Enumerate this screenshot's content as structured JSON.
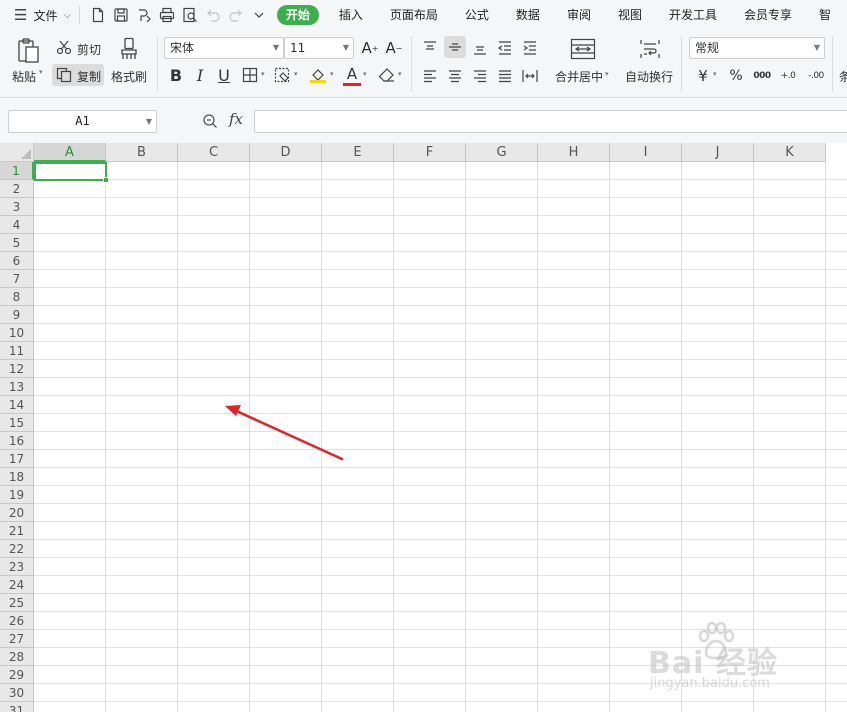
{
  "menubar": {
    "file_label": "文件",
    "tabs": [
      {
        "label": "开始",
        "active": true
      },
      {
        "label": "插入"
      },
      {
        "label": "页面布局"
      },
      {
        "label": "公式"
      },
      {
        "label": "数据"
      },
      {
        "label": "审阅"
      },
      {
        "label": "视图"
      },
      {
        "label": "开发工具"
      },
      {
        "label": "会员专享"
      },
      {
        "label": "智"
      }
    ]
  },
  "ribbon": {
    "paste_label": "粘贴",
    "cut_label": "剪切",
    "copy_label": "复制",
    "format_painter_label": "格式刷",
    "font_name": "宋体",
    "font_size": "11",
    "bold_label": "B",
    "italic_label": "I",
    "underline_label": "U",
    "font_color_label": "A",
    "merge_center_label": "合并居中",
    "wrap_text_label": "自动换行",
    "number_format": "常规",
    "currency_label": "¥",
    "percent_label": "%",
    "thousands_label": "000",
    "inc_decimal_label": "+.0",
    "dec_decimal_label": "-.00",
    "more_label": "条"
  },
  "formula_bar": {
    "name_box": "A1",
    "fx_label": "fx",
    "formula": ""
  },
  "sheet": {
    "columns": [
      "A",
      "B",
      "C",
      "D",
      "E",
      "F",
      "G",
      "H",
      "I",
      "J",
      "K"
    ],
    "rows": [
      "1",
      "2",
      "3",
      "4",
      "5",
      "6",
      "7",
      "8",
      "9",
      "10",
      "11",
      "12",
      "13",
      "14",
      "15",
      "16",
      "17",
      "18",
      "19",
      "20",
      "21",
      "22",
      "23",
      "24",
      "25",
      "26",
      "27",
      "28",
      "29",
      "30",
      "31"
    ],
    "active_cell": "A1"
  },
  "watermark": {
    "text": "Bai 经验",
    "url": "jingyan.baidu.com"
  },
  "colors": {
    "accent": "#3cae4b",
    "annotation_arrow": "#e0252a"
  }
}
